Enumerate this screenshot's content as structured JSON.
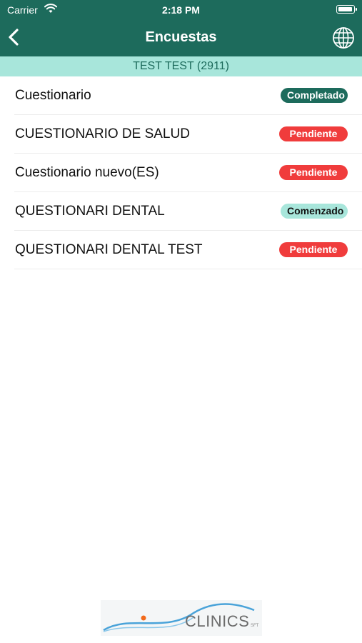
{
  "status_bar": {
    "carrier": "Carrier",
    "time": "2:18 PM"
  },
  "nav": {
    "title": "Encuestas",
    "back_icon": "chevron-left-icon",
    "globe_icon": "globe-icon"
  },
  "patient": {
    "label": "TEST TEST (2911)"
  },
  "colors": {
    "header": "#1d6b5c",
    "sub_bar": "#a8e6db",
    "pending": "#f03c3c",
    "completed": "#1d6b5c",
    "started": "#a8e6db"
  },
  "surveys": [
    {
      "title": "Cuestionario",
      "status": "Completado",
      "status_kind": "completed"
    },
    {
      "title": "CUESTIONARIO DE SALUD",
      "status": "Pendiente",
      "status_kind": "pending"
    },
    {
      "title": "Cuestionario nuevo(ES)",
      "status": "Pendiente",
      "status_kind": "pending"
    },
    {
      "title": "QUESTIONARI DENTAL",
      "status": "Comenzado",
      "status_kind": "started"
    },
    {
      "title": "QUESTIONARI DENTAL TEST",
      "status": "Pendiente",
      "status_kind": "pending"
    }
  ],
  "logo": {
    "text": "CLINICS",
    "subtext": "SFT"
  }
}
